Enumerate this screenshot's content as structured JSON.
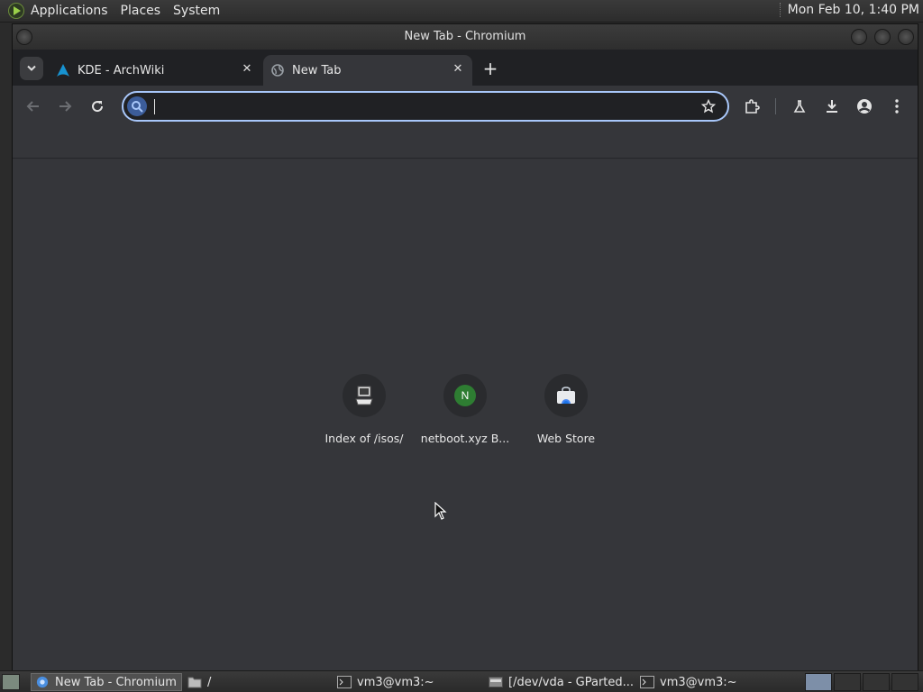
{
  "top_panel": {
    "menus": [
      "Applications",
      "Places",
      "System"
    ],
    "clock": "Mon Feb 10,  1:40 PM"
  },
  "window": {
    "title": "New Tab - Chromium"
  },
  "tabs": [
    {
      "label": "KDE - ArchWiki",
      "icon": "archwiki-icon",
      "active": false
    },
    {
      "label": "New Tab",
      "icon": "globe-icon",
      "active": true
    }
  ],
  "omnibox": {
    "value": "",
    "placeholder": ""
  },
  "shortcuts": [
    {
      "label": "Index of /isos/",
      "icon": "computer-icon"
    },
    {
      "label": "netboot.xyz B...",
      "icon": "letter-n-icon",
      "letter": "N"
    },
    {
      "label": "Web Store",
      "icon": "webstore-icon"
    }
  ],
  "taskbar": {
    "tasks": [
      {
        "label": "New Tab - Chromium",
        "icon": "chromium-icon",
        "active": true
      },
      {
        "label": "/",
        "icon": "folder-icon",
        "active": false
      },
      {
        "label": "vm3@vm3:~",
        "icon": "terminal-icon",
        "active": false
      },
      {
        "label": "[/dev/vda - GParted...",
        "icon": "gparted-icon",
        "active": false
      },
      {
        "label": "vm3@vm3:~",
        "icon": "terminal-icon",
        "active": false
      }
    ]
  },
  "colors": {
    "accent": "#a8c7fa",
    "tab_strip": "#202124",
    "toolbar": "#35363a",
    "netboot_badge": "#2e7d32"
  }
}
